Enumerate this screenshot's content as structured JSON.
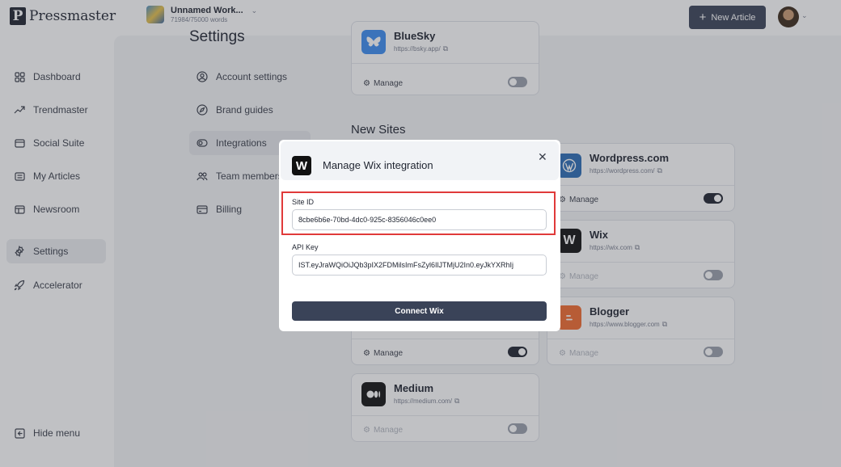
{
  "app": {
    "logo_letter": "P",
    "logo_text": "Pressmaster"
  },
  "workspace": {
    "name": "Unnamed Work...",
    "words": "71984/75000 words"
  },
  "header": {
    "new_article_label": "New Article"
  },
  "sidebar": {
    "items": [
      {
        "label": "Dashboard",
        "icon": "dashboard-grid-icon"
      },
      {
        "label": "Trendmaster",
        "icon": "trend-arrow-icon"
      },
      {
        "label": "Social Suite",
        "icon": "social-window-icon"
      },
      {
        "label": "My Articles",
        "icon": "articles-icon"
      },
      {
        "label": "Newsroom",
        "icon": "newsroom-icon"
      },
      {
        "label": "Settings",
        "icon": "gear-icon",
        "active": true
      },
      {
        "label": "Accelerator",
        "icon": "rocket-icon"
      }
    ],
    "hide_menu_label": "Hide menu"
  },
  "settings": {
    "title": "Settings",
    "nav": [
      {
        "label": "Account settings",
        "icon": "user-circle-icon"
      },
      {
        "label": "Brand guides",
        "icon": "compass-icon"
      },
      {
        "label": "Integrations",
        "icon": "toggle-icon",
        "active": true
      },
      {
        "label": "Team members",
        "icon": "team-icon"
      },
      {
        "label": "Billing",
        "icon": "card-icon"
      }
    ]
  },
  "integrations": {
    "new_sites_title": "New Sites",
    "manage_label": "Manage",
    "cards": [
      {
        "name": "BlueSky",
        "url": "https://bsky.app/",
        "enabled": false
      },
      {
        "name": "Wordpress.com",
        "url": "https://wordpress.com/",
        "enabled": true
      },
      {
        "name": "Wix",
        "url": "https://wix.com",
        "enabled": false
      },
      {
        "name": "Blogger",
        "url": "https://www.blogger.com",
        "enabled": false
      },
      {
        "name": "",
        "url": "",
        "enabled": true
      },
      {
        "name": "Medium",
        "url": "https://medium.com/",
        "enabled": false
      }
    ]
  },
  "modal": {
    "logo_letter": "W",
    "title": "Manage Wix integration",
    "site_id_label": "Site ID",
    "site_id_value": "8cbe6b6e-70bd-4dc0-925c-8356046c0ee0",
    "api_key_label": "API Key",
    "api_key_value": "IST.eyJraWQiOiJQb3pIX2FDMilsImFsZyl6IlJTMjU2In0.eyJkYXRhIj",
    "connect_label": "Connect Wix"
  },
  "colors": {
    "primary": "#3a4358",
    "highlight": "#e03a3a",
    "bluesky": "#3b8cf0",
    "wordpress": "#2c6cb5",
    "blogger": "#f26b2e"
  }
}
